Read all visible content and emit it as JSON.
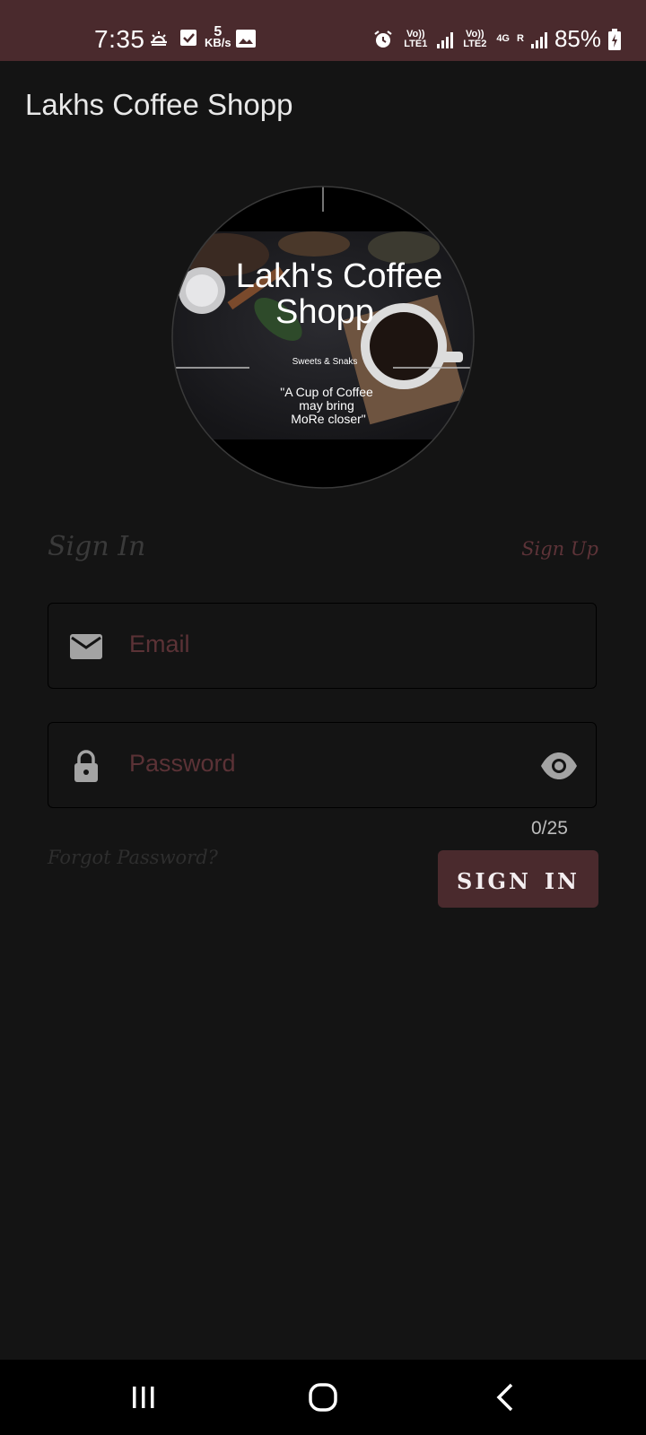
{
  "status_bar": {
    "time": "7:35",
    "speed_value": "5",
    "speed_unit": "KB/s",
    "sim1": "Vo)) LTE1",
    "sim2": "Vo)) LTE2",
    "net_type": "4G",
    "roaming": "R",
    "battery": "85%",
    "icons": [
      "weather-sunrise-icon",
      "checkbox-icon",
      "gallery-icon",
      "alarm-icon",
      "signal-icon",
      "battery-charging-icon"
    ]
  },
  "app_bar": {
    "title": "Lakhs Coffee Shopp"
  },
  "logo": {
    "title_line1": "Lakh's Coffee",
    "title_line2": "Shopp",
    "tagline": "Sweets & Snaks",
    "quote_line1": "\"A Cup of Coffee",
    "quote_line2": "may bring",
    "quote_line3": "MoRe closer\""
  },
  "tabs": {
    "sign_in": "Sign In",
    "sign_up": "Sign Up"
  },
  "form": {
    "email_label": "Email",
    "password_label": "Password",
    "password_counter": "0/25",
    "forgot_password": "Forgot Password?",
    "sign_in_button": "SIGN IN"
  },
  "colors": {
    "accent": "#4a2a2d",
    "background": "#141414",
    "label": "#5b3236"
  },
  "nav_bar": {
    "icons": [
      "recent-apps-icon",
      "home-icon",
      "back-icon"
    ]
  }
}
